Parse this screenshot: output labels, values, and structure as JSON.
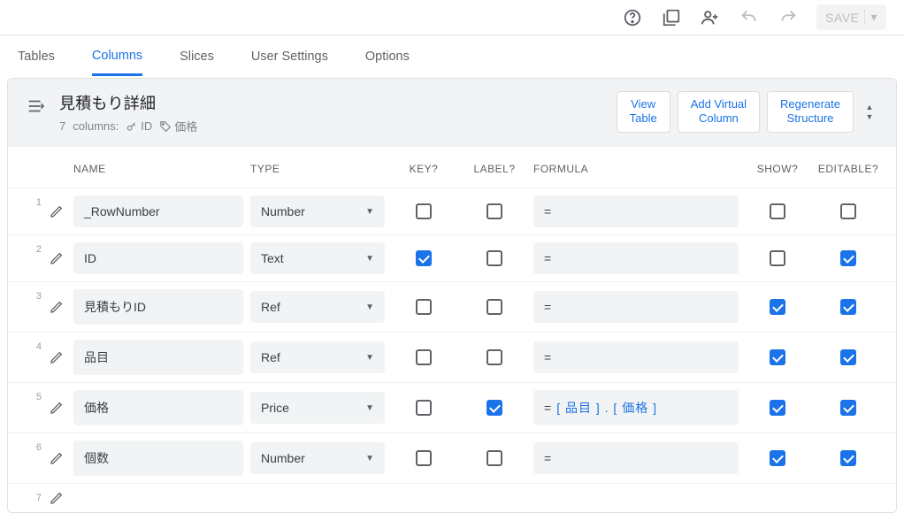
{
  "topbar": {
    "save_label": "SAVE"
  },
  "tabs": [
    {
      "label": "Tables",
      "active": false
    },
    {
      "label": "Columns",
      "active": true
    },
    {
      "label": "Slices",
      "active": false
    },
    {
      "label": "User Settings",
      "active": false
    },
    {
      "label": "Options",
      "active": false
    }
  ],
  "panel": {
    "title": "見積もり詳細",
    "columns_count": "7",
    "columns_suffix": "columns:",
    "key_label": "ID",
    "label_label": "価格",
    "actions": {
      "view_table": "View\nTable",
      "add_virtual": "Add Virtual\nColumn",
      "regenerate": "Regenerate\nStructure"
    }
  },
  "headers": {
    "name": "NAME",
    "type": "TYPE",
    "key": "KEY?",
    "label": "LABEL?",
    "formula": "FORMULA",
    "show": "SHOW?",
    "editable": "EDITABLE?"
  },
  "rows": [
    {
      "num": "1",
      "name": "_RowNumber",
      "type": "Number",
      "key": false,
      "label": false,
      "formula": "=",
      "formula_ref": "",
      "show": false,
      "editable": false
    },
    {
      "num": "2",
      "name": "ID",
      "type": "Text",
      "key": true,
      "label": false,
      "formula": "=",
      "formula_ref": "",
      "show": false,
      "editable": true
    },
    {
      "num": "3",
      "name": "見積もりID",
      "type": "Ref",
      "key": false,
      "label": false,
      "formula": "=",
      "formula_ref": "",
      "show": true,
      "editable": true
    },
    {
      "num": "4",
      "name": "品目",
      "type": "Ref",
      "key": false,
      "label": false,
      "formula": "=",
      "formula_ref": "",
      "show": true,
      "editable": true
    },
    {
      "num": "5",
      "name": "価格",
      "type": "Price",
      "key": false,
      "label": true,
      "formula": "=",
      "formula_ref": "[ 品目 ] . [ 価格 ]",
      "show": true,
      "editable": true
    },
    {
      "num": "6",
      "name": "個数",
      "type": "Number",
      "key": false,
      "label": false,
      "formula": "=",
      "formula_ref": "",
      "show": true,
      "editable": true
    },
    {
      "num": "7",
      "name": "",
      "type": "",
      "key": false,
      "label": false,
      "formula": "",
      "formula_ref": "",
      "show": true,
      "editable": true
    }
  ]
}
